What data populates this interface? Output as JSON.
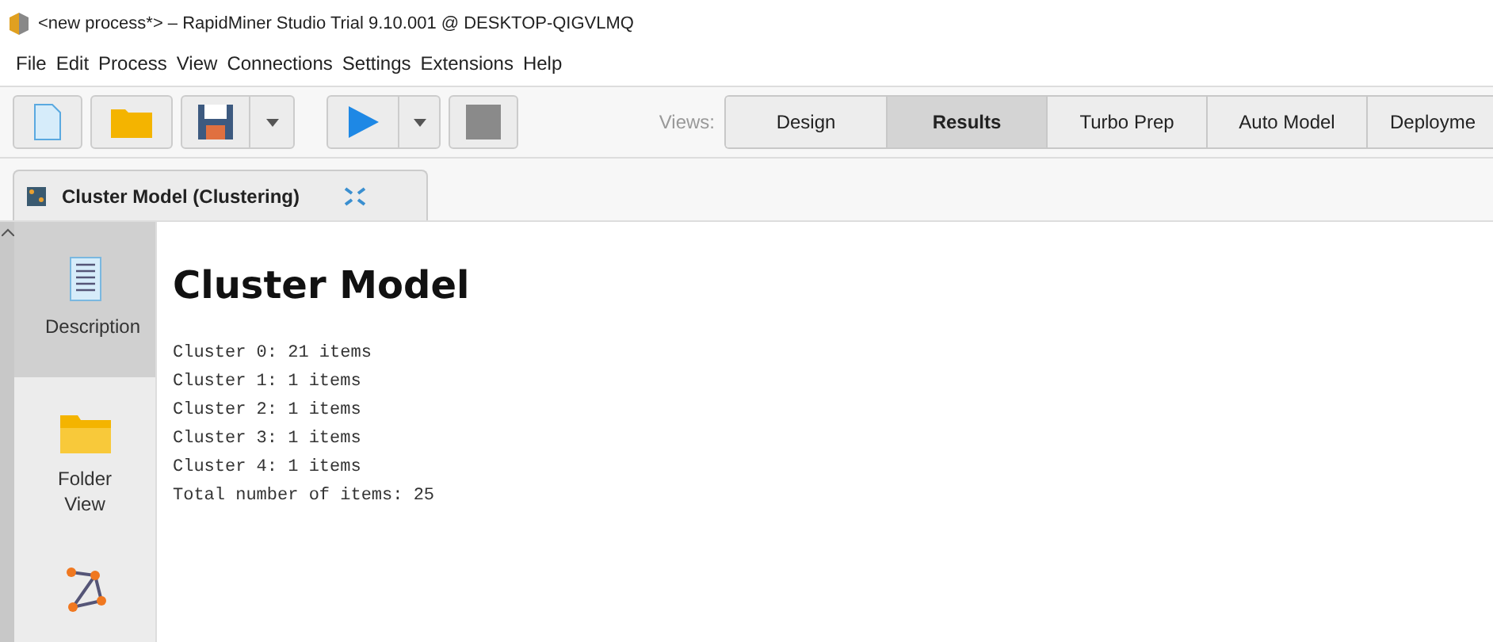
{
  "window": {
    "title": "<new process*> – RapidMiner Studio Trial 9.10.001 @ DESKTOP-QIGVLMQ"
  },
  "menu": [
    "File",
    "Edit",
    "Process",
    "View",
    "Connections",
    "Settings",
    "Extensions",
    "Help"
  ],
  "views": {
    "label": "Views:",
    "tabs": [
      {
        "label": "Design",
        "selected": false
      },
      {
        "label": "Results",
        "selected": true
      },
      {
        "label": "Turbo Prep",
        "selected": false
      },
      {
        "label": "Auto Model",
        "selected": false
      },
      {
        "label": "Deployme",
        "selected": false
      }
    ]
  },
  "result_tab": {
    "label": "Cluster Model (Clustering)"
  },
  "sidebar": {
    "items": [
      {
        "kind": "description",
        "label": "Description",
        "selected": true
      },
      {
        "kind": "folder",
        "label": "Folder View",
        "selected": false
      },
      {
        "kind": "graph",
        "selected": false
      }
    ]
  },
  "content": {
    "title": "Cluster Model",
    "lines": [
      "Cluster 0: 21 items",
      "Cluster 1: 1 items",
      "Cluster 2: 1 items",
      "Cluster 3: 1 items",
      "Cluster 4: 1 items",
      "Total number of items: 25"
    ]
  }
}
